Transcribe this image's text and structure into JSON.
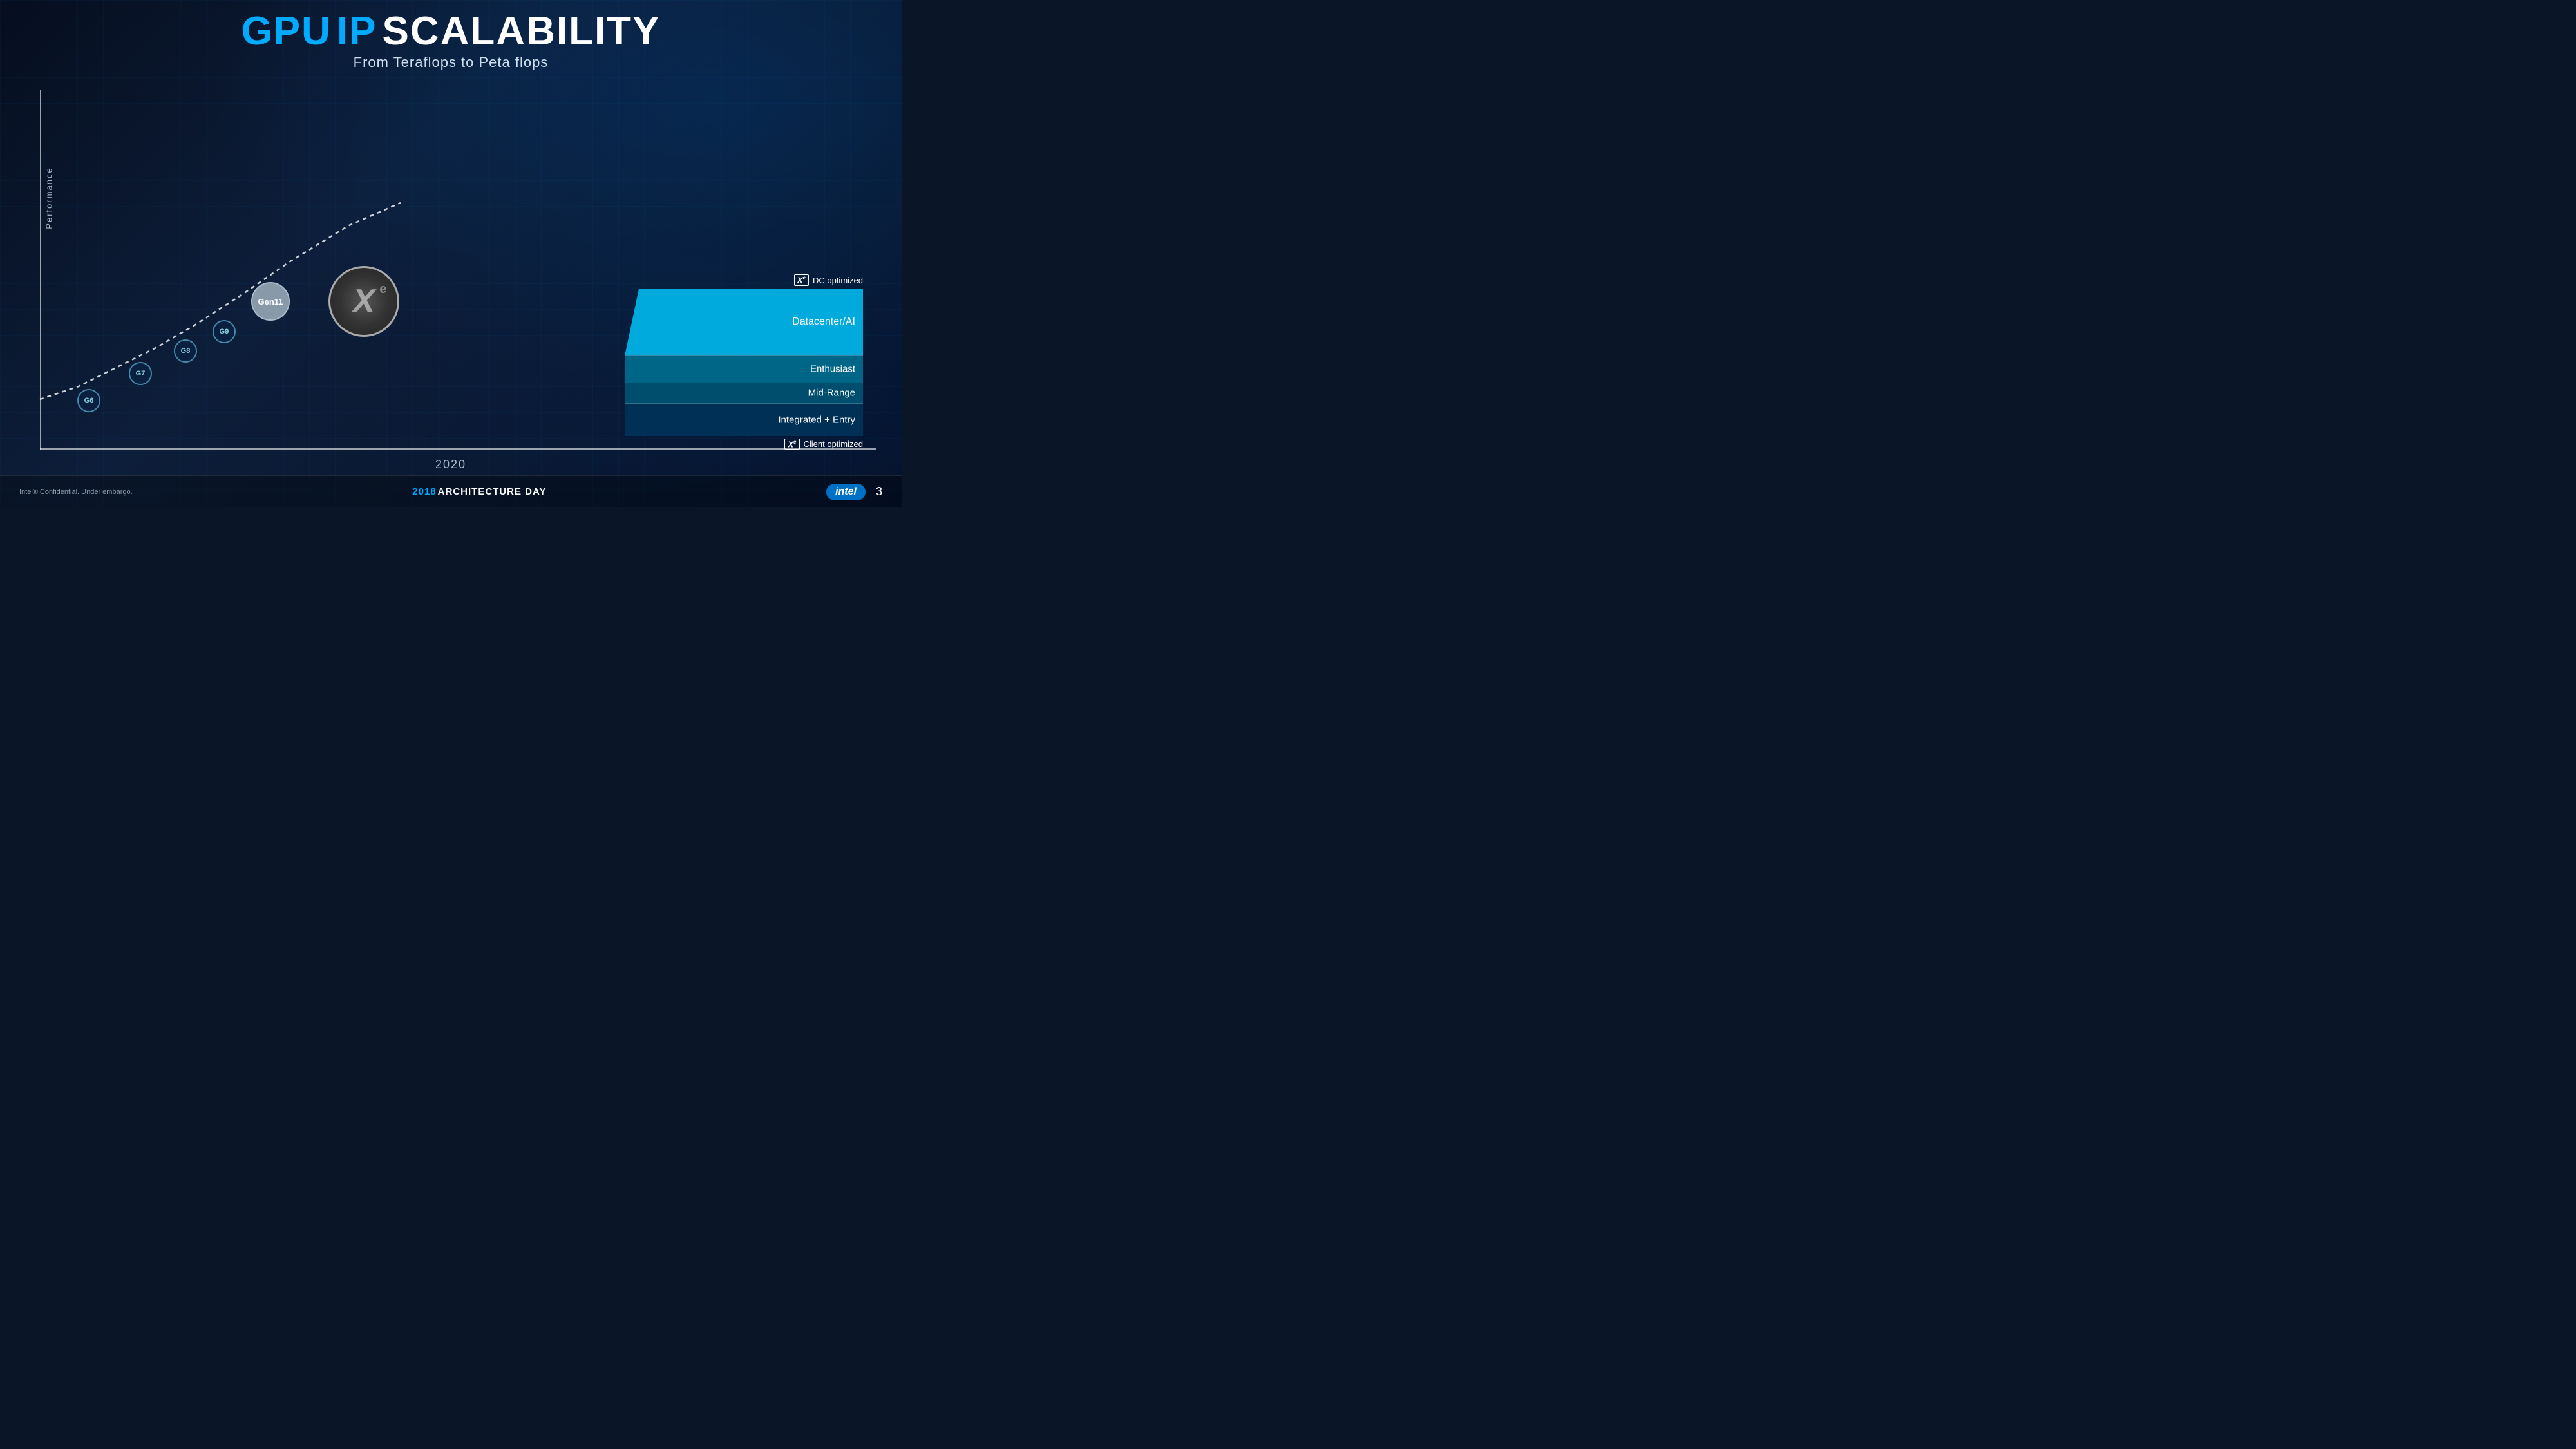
{
  "header": {
    "title_gpu": "GPU",
    "title_ip": "IP",
    "title_scalability": "SCALABILITY",
    "subtitle": "From Teraflops to Peta flops"
  },
  "chart": {
    "y_axis_label": "Performance",
    "x_axis_label": "2020",
    "generations": [
      {
        "id": "g6",
        "label": "G6"
      },
      {
        "id": "g7",
        "label": "G7"
      },
      {
        "id": "g8",
        "label": "G8"
      },
      {
        "id": "g9",
        "label": "G9"
      },
      {
        "id": "gen11",
        "label": "Gen11"
      }
    ],
    "xe_label": "X",
    "xe_superscript": "e"
  },
  "bars": {
    "dc_optimized_label": "DC optimized",
    "client_optimized_label": "Client optimized",
    "tiers": [
      {
        "id": "datacenter",
        "label": "Datacenter/AI"
      },
      {
        "id": "enthusiast",
        "label": "Enthusiast"
      },
      {
        "id": "midrange",
        "label": "Mid-Range"
      },
      {
        "id": "integrated",
        "label": "Integrated + Entry"
      }
    ]
  },
  "footer": {
    "confidential": "Intel® Confidential. Under embargo.",
    "year": "2018",
    "event": "ARCHITECTURE DAY",
    "brand": "intel",
    "page": "3"
  }
}
